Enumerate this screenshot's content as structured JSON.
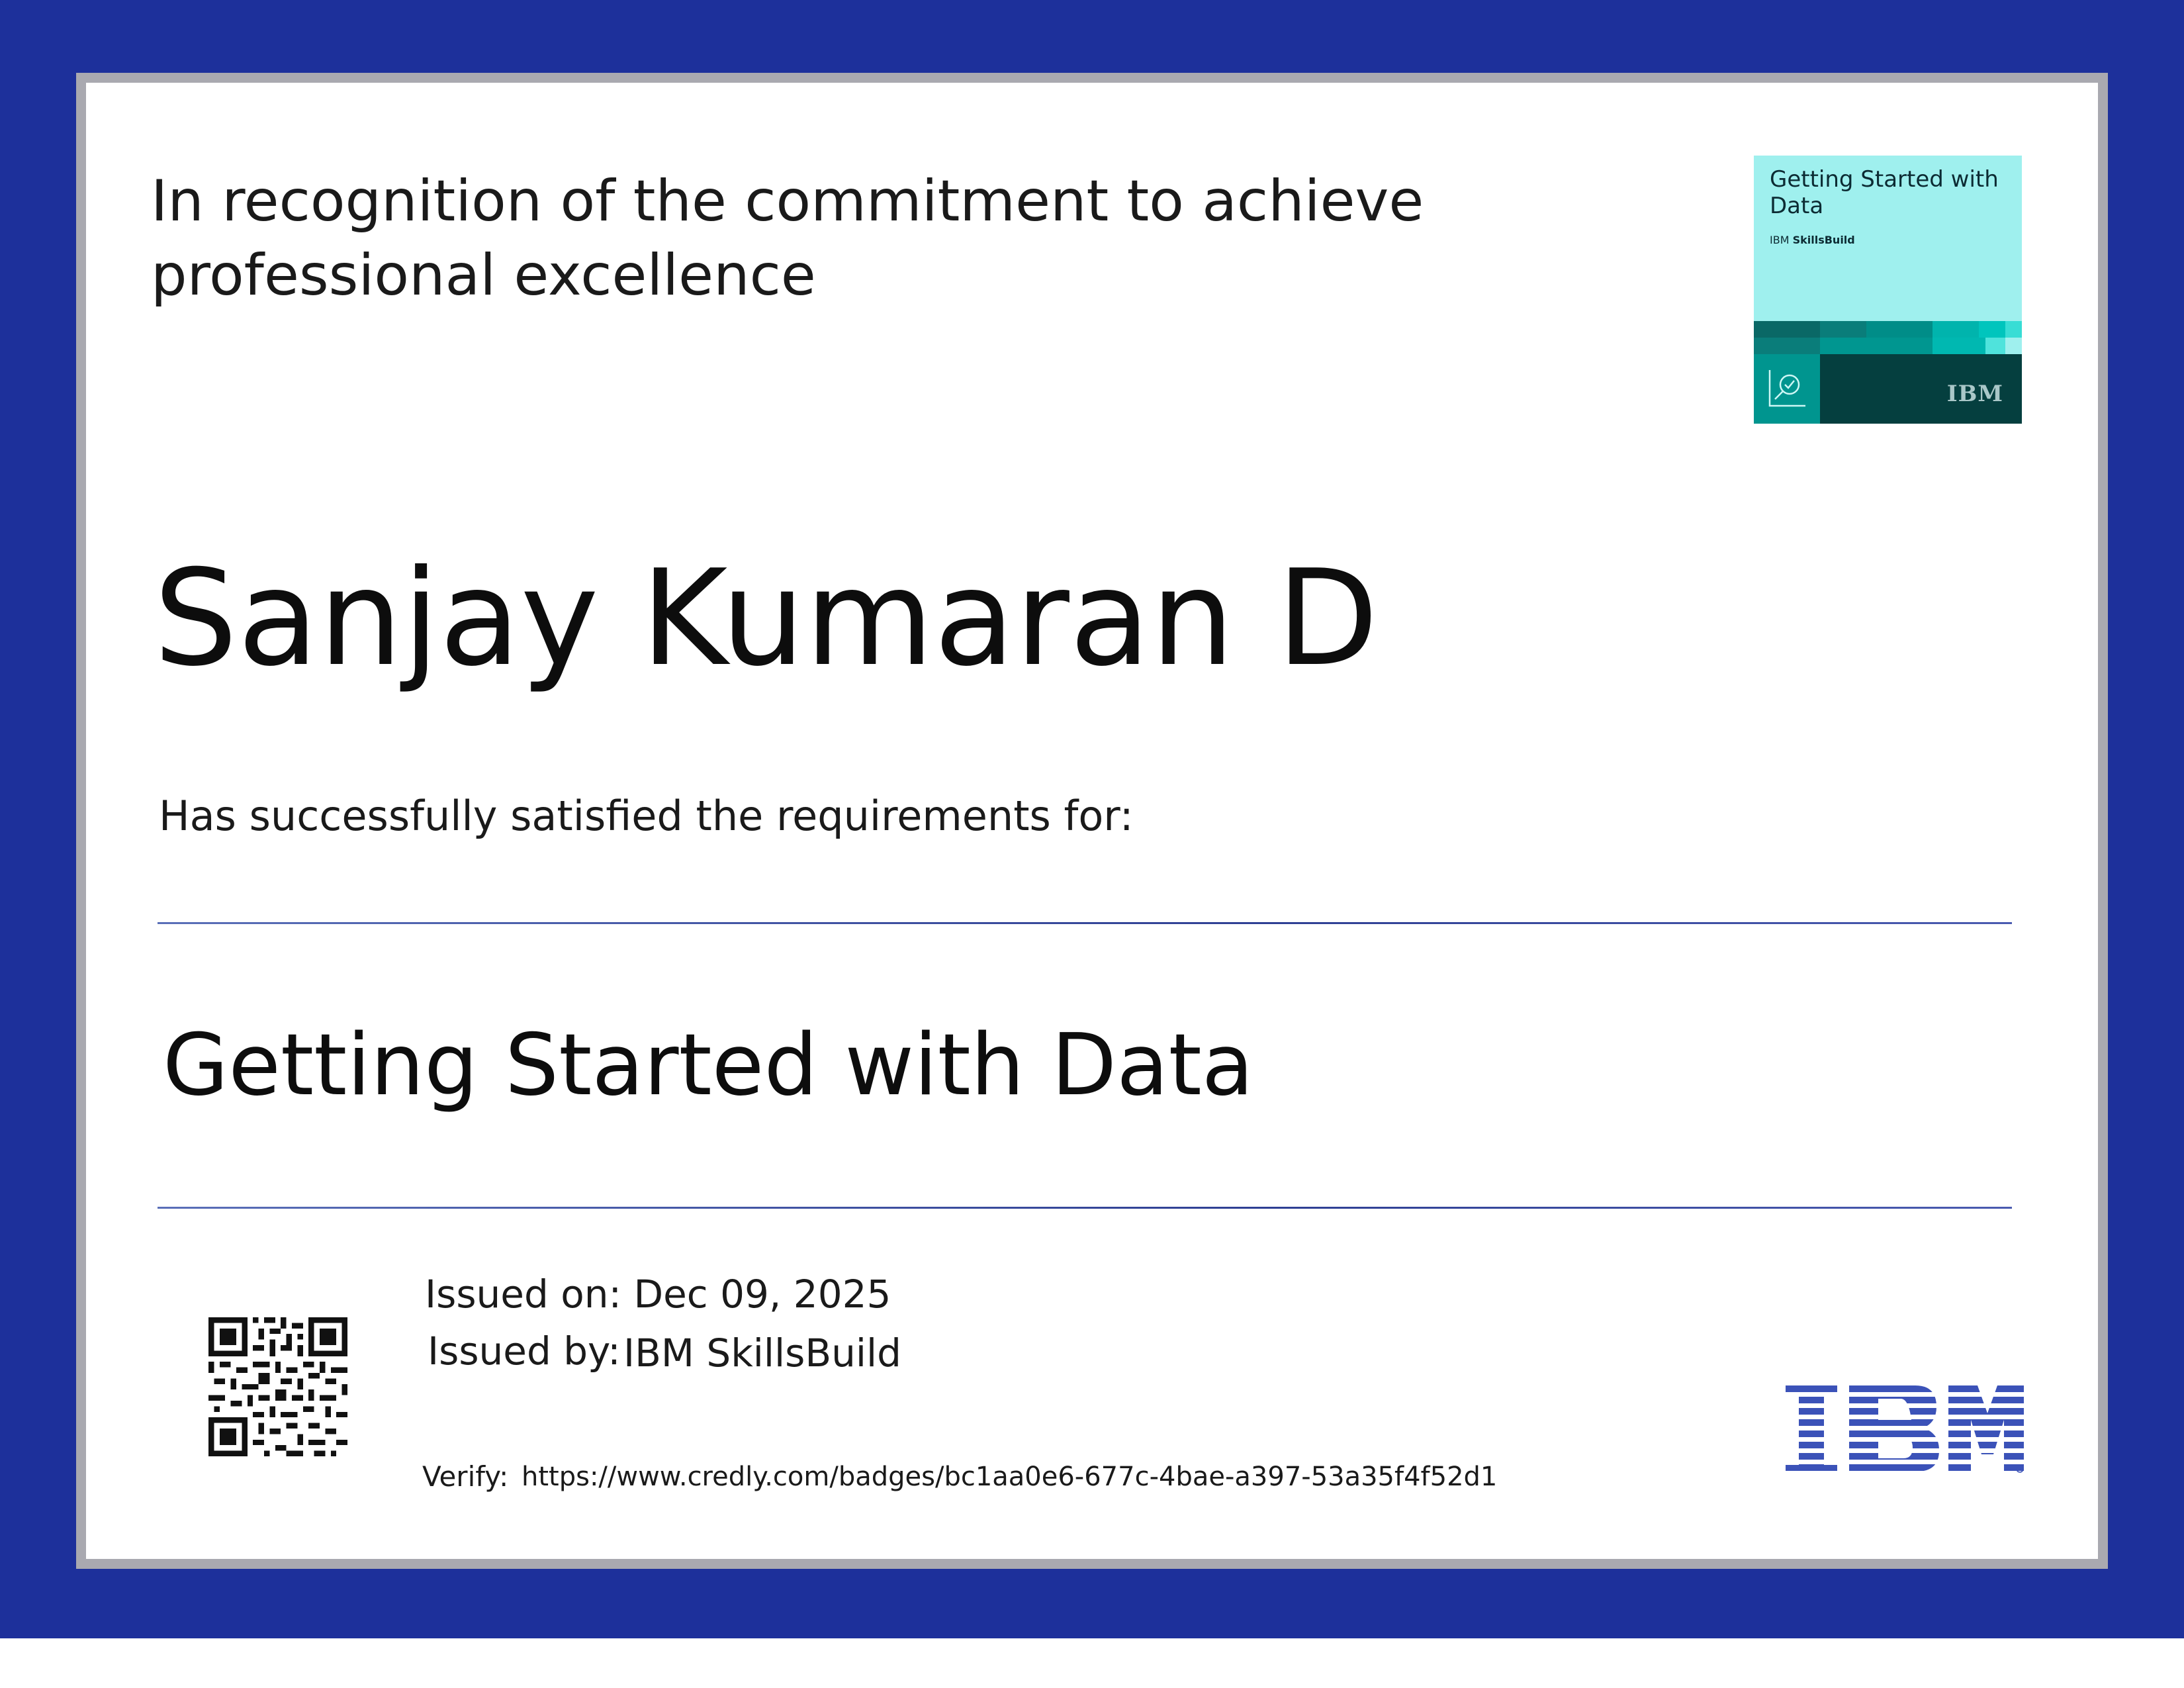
{
  "certificate": {
    "recognition_line": "In recognition of the commitment to achieve professional excellence",
    "recipient_name": "Sanjay Kumaran D",
    "satisfied_text": "Has successfully satisfied the requirements for:",
    "course_title": "Getting Started with Data",
    "issued_on": "Issued on: Dec 09, 2025",
    "issued_by_label": "Issued by:",
    "issued_by_value": "IBM SkillsBuild",
    "verify_label": "Verify:",
    "verify_url": "https://www.credly.com/badges/bc1aa0e6-677c-4bae-a397-53a35f4f52d1"
  },
  "badge": {
    "title": "Getting Started with Data",
    "subtitle_prefix": "IBM",
    "subtitle_brand": "SkillsBuild",
    "logo_text": "IBM",
    "icon": "data-analysis-icon"
  },
  "logos": {
    "ibm": "ibm-logo",
    "ibm_color": "#3b52b8"
  },
  "colors": {
    "frame_blue": "#1d309b",
    "badge_cyan": "#9ff0ee",
    "badge_teal_dark": "#053f3f",
    "badge_teal": "#00958f"
  }
}
